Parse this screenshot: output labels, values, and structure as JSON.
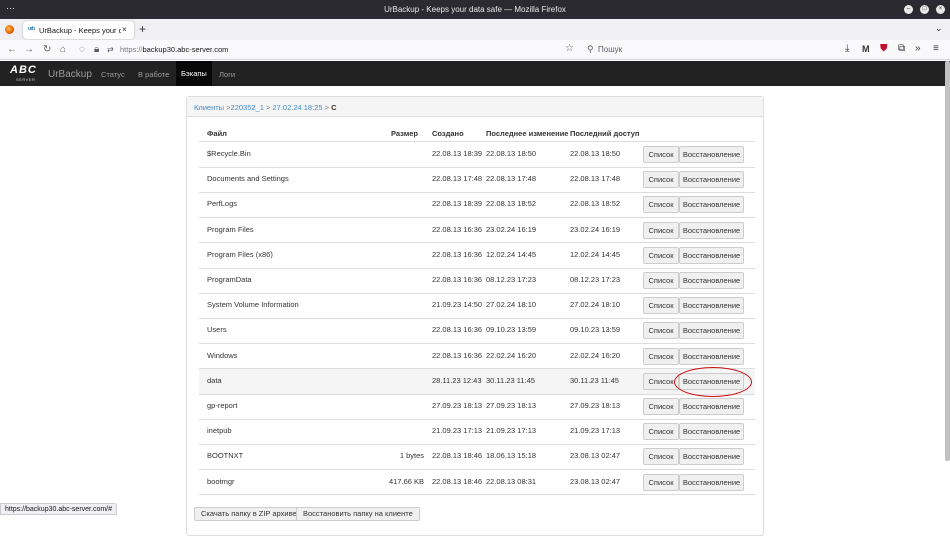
{
  "window": {
    "title": "UrBackup - Keeps your data safe — Mozilla Firefox"
  },
  "tab": {
    "favicon": "urb",
    "title": "UrBackup - Keeps your data",
    "close": "×"
  },
  "browser": {
    "url_scheme": "https://",
    "url_host": "backup30.abc-server.com",
    "search_placeholder": "Пошук",
    "status_url": "https://backup30.abc-server.com/#"
  },
  "app": {
    "logo_text": "ABC",
    "logo_sub": "SERVER",
    "brand": "UrBackup",
    "nav": [
      {
        "label": "Статус"
      },
      {
        "label": "В работе"
      },
      {
        "label": "Бэкапы"
      },
      {
        "label": "Логи"
      }
    ],
    "active_nav": "Бэкапы"
  },
  "breadcrumb": {
    "clients": "Клиенты",
    "sep1": " >",
    "client": "220352_1",
    "sep2": " > ",
    "backup": "27.02.24 18:25",
    "sep3": " > ",
    "current": "C"
  },
  "table": {
    "headers": [
      "Файл",
      "Размер",
      "Создано",
      "Последнее изменение",
      "Последний доступ"
    ],
    "rows": [
      {
        "name": "$Recycle.Bin",
        "size": "",
        "created": "22.08.13 18:39",
        "modified": "22.08.13 18:50",
        "accessed": "22.08.13 18:50"
      },
      {
        "name": "Documents and Settings",
        "size": "",
        "created": "22.08.13 17:48",
        "modified": "22.08.13 17:48",
        "accessed": "22.08.13 17:48"
      },
      {
        "name": "PerfLogs",
        "size": "",
        "created": "22.08.13 18:39",
        "modified": "22.08.13 18:52",
        "accessed": "22.08.13 18:52"
      },
      {
        "name": "Program Files",
        "size": "",
        "created": "22.08.13 16:36",
        "modified": "23.02.24 16:19",
        "accessed": "23.02.24 16:19"
      },
      {
        "name": "Program Files (x86)",
        "size": "",
        "created": "22.08.13 16:36",
        "modified": "12.02.24 14:45",
        "accessed": "12.02.24 14:45"
      },
      {
        "name": "ProgramData",
        "size": "",
        "created": "22.08.13 16:36",
        "modified": "08.12.23 17:23",
        "accessed": "08.12.23 17:23"
      },
      {
        "name": "System Volume Information",
        "size": "",
        "created": "21.09.23 14:50",
        "modified": "27.02.24 18:10",
        "accessed": "27.02.24 18:10"
      },
      {
        "name": "Users",
        "size": "",
        "created": "22.08.13 16:36",
        "modified": "09.10.23 13:59",
        "accessed": "09.10.23 13:59"
      },
      {
        "name": "Windows",
        "size": "",
        "created": "22.08.13 16:36",
        "modified": "22.02.24 16:20",
        "accessed": "22.02.24 16:20"
      },
      {
        "name": "data",
        "size": "",
        "created": "28.11.23 12:43",
        "modified": "30.11.23 11:45",
        "accessed": "30.11.23 11:45"
      },
      {
        "name": "gp-report",
        "size": "",
        "created": "27.09.23 18:13",
        "modified": "27.09.23 18:13",
        "accessed": "27.09.23 18:13"
      },
      {
        "name": "inetpub",
        "size": "",
        "created": "21.09.23 17:13",
        "modified": "21.09.23 17:13",
        "accessed": "21.09.23 17:13"
      },
      {
        "name": "BOOTNXT",
        "size": "1 bytes",
        "created": "22.08.13 18:46",
        "modified": "18.06.13 15:18",
        "accessed": "23.08.13 02:47"
      },
      {
        "name": "bootmgr",
        "size": "417.66 KB",
        "created": "22.08.13 18:46",
        "modified": "22.08.13 08:31",
        "accessed": "23.08.13 02:47"
      }
    ],
    "list_button": "Список",
    "restore_button": "Восстановление",
    "highlighted_row": 9
  },
  "bottom_buttons": {
    "zip": "Скачать папку в ZIP архиве",
    "restore_client": "Восстановить папку на клиенте"
  },
  "colors": {
    "annotation_circle": "#d01010",
    "link": "#428bca",
    "navbar": "#222222"
  }
}
